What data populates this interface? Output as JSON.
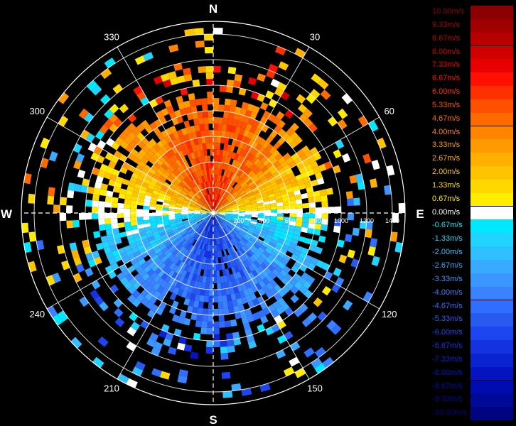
{
  "chart_data": {
    "type": "heatmap",
    "projection": "polar-ppi",
    "compass": {
      "north": "N",
      "south": "S",
      "east": "E",
      "west": "W"
    },
    "azimuth_ticks": [
      "30",
      "60",
      "120",
      "150",
      "210",
      "240",
      "300",
      "330"
    ],
    "range_ticks": [
      "200",
      "400",
      "600",
      "800",
      "1000",
      "1200",
      "1400"
    ],
    "range_max": 1500,
    "units": "m/s",
    "grid": true,
    "pattern": "positive radial velocity over the northern half, negative over the southern half; sparse scattered gates at far range",
    "colorbar": [
      {
        "label": "10.00m/s",
        "color": "#8b0000"
      },
      {
        "label": "9.33m/s",
        "color": "#a00000"
      },
      {
        "label": "8.67m/s",
        "color": "#b80000"
      },
      {
        "label": "8.00m/s",
        "color": "#d00000"
      },
      {
        "label": "7.33m/s",
        "color": "#e80000"
      },
      {
        "label": "6.67m/s",
        "color": "#ff1000"
      },
      {
        "label": "6.00m/s",
        "color": "#ff3000"
      },
      {
        "label": "5.33m/s",
        "color": "#ff5000"
      },
      {
        "label": "4.67m/s",
        "color": "#ff6a00"
      },
      {
        "label": "4.00m/s",
        "color": "#ff8400"
      },
      {
        "label": "3.33m/s",
        "color": "#ff9a00"
      },
      {
        "label": "2.67m/s",
        "color": "#ffb000"
      },
      {
        "label": "2.00m/s",
        "color": "#ffc400"
      },
      {
        "label": "1.33m/s",
        "color": "#ffd800"
      },
      {
        "label": "0.67m/s",
        "color": "#ffec00"
      },
      {
        "label": "0.00m/s",
        "color": "#ffffff"
      },
      {
        "label": "-0.67m/s",
        "color": "#00e8ff"
      },
      {
        "label": "-1.33m/s",
        "color": "#20d4ff"
      },
      {
        "label": "-2.00m/s",
        "color": "#30c0ff"
      },
      {
        "label": "-2.67m/s",
        "color": "#38aaff"
      },
      {
        "label": "-3.33m/s",
        "color": "#3c96ff"
      },
      {
        "label": "-4.00m/s",
        "color": "#3a82ff"
      },
      {
        "label": "-4.67m/s",
        "color": "#306eff"
      },
      {
        "label": "-5.33m/s",
        "color": "#285af0"
      },
      {
        "label": "-6.00m/s",
        "color": "#1e46f0"
      },
      {
        "label": "-6.67m/s",
        "color": "#1432e0"
      },
      {
        "label": "-7.33m/s",
        "color": "#0a22d0"
      },
      {
        "label": "-8.00m/s",
        "color": "#0414c0"
      },
      {
        "label": "-8.67m/s",
        "color": "#000cb0"
      },
      {
        "label": "-9.33m/s",
        "color": "#000898"
      },
      {
        "label": "-10.00m/s",
        "color": "#000480"
      }
    ]
  }
}
